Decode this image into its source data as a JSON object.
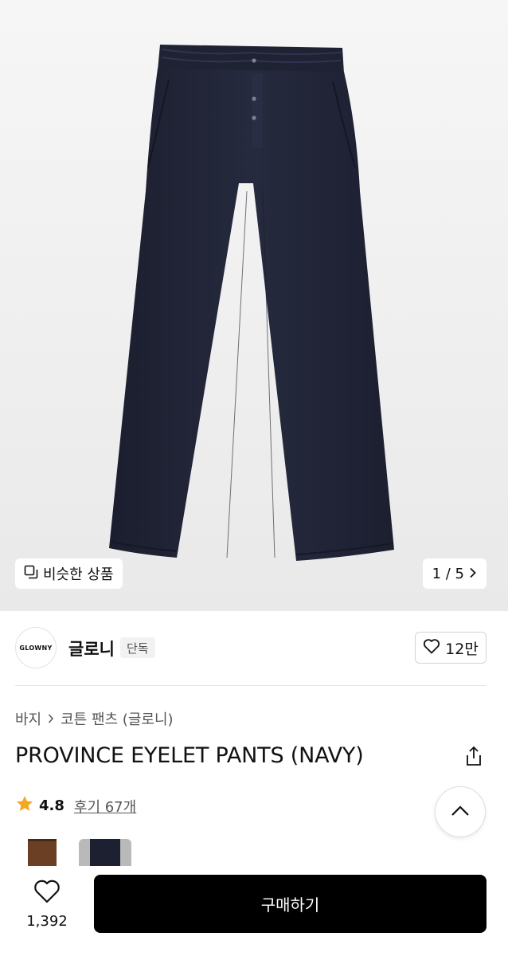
{
  "gallery": {
    "similar_label": "비슷한 상품",
    "pager_text": "1 / 5"
  },
  "brand": {
    "logo_text": "GLOWNY",
    "name": "글로니",
    "badge": "단독",
    "like_count": "12만"
  },
  "breadcrumb": {
    "category": "바지",
    "subcategory": "코튼 팬츠 (글로니)"
  },
  "product": {
    "title": "PROVINCE EYELET PANTS (NAVY)",
    "rating": "4.8",
    "reviews": "후기 67개",
    "color_options": [
      {
        "name": "brown",
        "color": "#6b3f24"
      },
      {
        "name": "navy",
        "color": "#1d2030"
      }
    ]
  },
  "bottom": {
    "wish_count": "1,392",
    "buy_label": "구매하기"
  },
  "colors": {
    "pants": "#23263a",
    "star": "#f5a623",
    "buy_button": "#000000"
  },
  "icons": {
    "similar": "copy-squares-icon",
    "pager": "chevron-right-icon",
    "like": "heart-outline-icon",
    "share": "share-icon",
    "star": "star-icon",
    "scroll_top": "chevron-up-icon",
    "wish": "heart-outline-icon"
  }
}
